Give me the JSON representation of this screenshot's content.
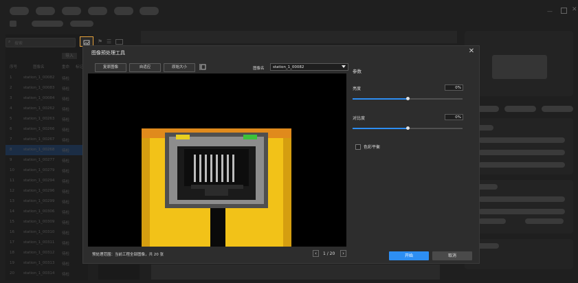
{
  "left": {
    "search_placeholder": "搜索",
    "import_label": "导入",
    "columns": [
      "序号",
      "图像名",
      "重命",
      "标记"
    ],
    "rows": [
      {
        "index": "1",
        "name": "station_1_00082",
        "tag": "待检"
      },
      {
        "index": "2",
        "name": "station_1_00083",
        "tag": "待检"
      },
      {
        "index": "3",
        "name": "station_1_00084",
        "tag": "待检"
      },
      {
        "index": "4",
        "name": "station_1_00262",
        "tag": "待检"
      },
      {
        "index": "5",
        "name": "station_1_00263",
        "tag": "待检"
      },
      {
        "index": "6",
        "name": "station_1_00266",
        "tag": "待检"
      },
      {
        "index": "7",
        "name": "station_1_00267",
        "tag": "待检"
      },
      {
        "index": "8",
        "name": "station_1_00268",
        "tag": "待检"
      },
      {
        "index": "9",
        "name": "station_1_00277",
        "tag": "待检"
      },
      {
        "index": "10",
        "name": "station_1_00279",
        "tag": "待检"
      },
      {
        "index": "11",
        "name": "station_1_00294",
        "tag": "待检"
      },
      {
        "index": "12",
        "name": "station_1_00296",
        "tag": "待检"
      },
      {
        "index": "13",
        "name": "station_1_00299",
        "tag": "待检"
      },
      {
        "index": "14",
        "name": "station_1_00306",
        "tag": "待检"
      },
      {
        "index": "15",
        "name": "station_1_00309",
        "tag": "待检"
      },
      {
        "index": "16",
        "name": "station_1_00310",
        "tag": "待检"
      },
      {
        "index": "17",
        "name": "station_1_00311",
        "tag": "待检"
      },
      {
        "index": "18",
        "name": "station_1_00312",
        "tag": "待检"
      },
      {
        "index": "19",
        "name": "station_1_00313",
        "tag": "待检"
      },
      {
        "index": "20",
        "name": "station_1_00314",
        "tag": "待检"
      }
    ]
  },
  "dialog": {
    "title": "图像预处理工具",
    "toolbar": {
      "restore": "复原图像",
      "fit": "自适应",
      "original": "原始大小",
      "image_name_label": "图像名",
      "image_name_value": "station_1_00082"
    },
    "bottom": {
      "range_text": "预处理范围：当前工程全部图像，共 20 张",
      "page": "1 / 20"
    },
    "params": {
      "title": "参数",
      "brightness_label": "亮度",
      "brightness_value": "0%",
      "brightness_level": 0.5,
      "contrast_label": "对比度",
      "contrast_value": "0%",
      "contrast_level": 0.5,
      "color_balance_label": "色彩平衡"
    },
    "start_label": "开始",
    "cancel_label": "取消"
  },
  "colors": {
    "accent": "#2d8ef3",
    "selected_row": "#1b2d45",
    "highlight_box": "#e8a33b"
  }
}
